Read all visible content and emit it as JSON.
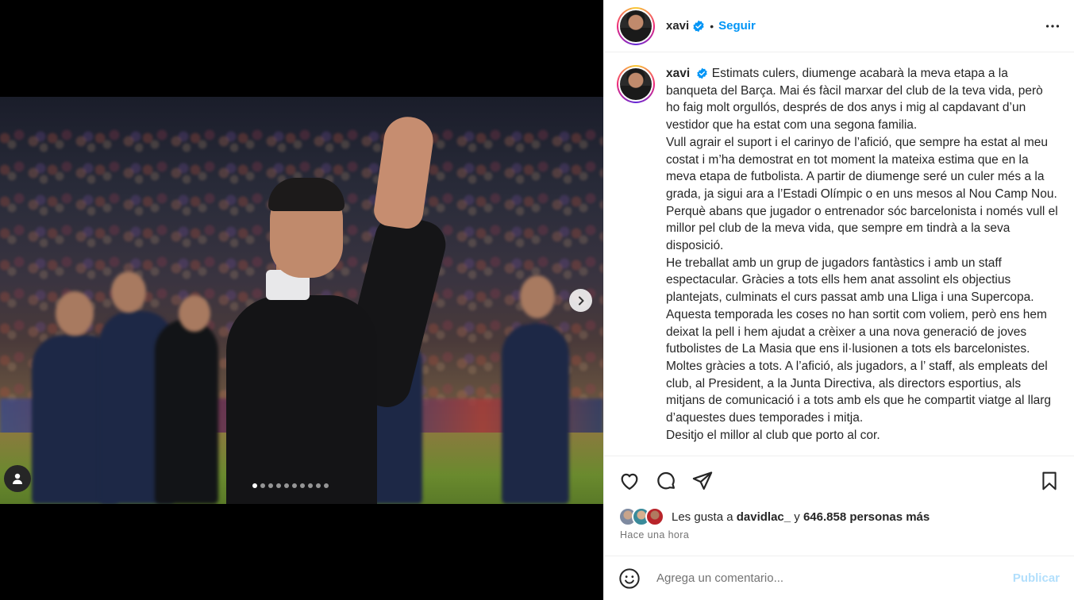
{
  "post": {
    "username": "xavi",
    "verified_icon": "verified-badge-icon",
    "separator": "•",
    "follow_label": "Seguir",
    "carousel_total": 10,
    "carousel_active": 1,
    "caption": "Estimats culers, diumenge acabarà la meva etapa a la banqueta del Barça. Mai és fàcil marxar del club de la teva vida, però ho faig molt orgullós, després de dos anys i mig al capdavant d’un vestidor que ha estat com una segona familia.\nVull agrair el suport i el carinyo de l’afició, que sempre ha estat al meu costat i m’ha demostrat en tot moment la mateixa estima que en la meva etapa de futbolista. A partir de diumenge seré un culer més a la grada, ja sigui ara a l’Estadi Olímpic o en uns mesos al Nou Camp Nou. Perquè abans que jugador o entrenador sóc barcelonista i només vull el millor pel club de la meva vida, que sempre em tindrà a la seva disposició.\nHe treballat amb un grup de jugadors fantàstics i amb un staff espectacular. Gràcies a tots ells hem anat assolint els objectius plantejats, culminats el curs passat amb una Lliga i una Supercopa. Aquesta temporada les coses no han sortit com voliem, però ens hem deixat la pell i hem ajudat a crèixer a una nova generació de joves futbolistes de La Masia que ens il·lusionen a tots els barcelonistes.\nMoltes gràcies a tots. A l’afició, als jugadors, a l’ staff, als empleats del club, al President, a la Junta Directiva, als directors esportius, als mitjans de comunicació i a tots amb els que he compartit viatge al llarg d’aquestes dues temporades i mitja.\nDesitjo el millor al club que porto al cor."
  },
  "likes": {
    "prefix": "Les gusta a",
    "user": "davidlac_",
    "connector": "y",
    "others": "646.858 personas más"
  },
  "time_label": "Hace una hora",
  "comment": {
    "placeholder": "Agrega un comentario...",
    "publish_label": "Publicar"
  },
  "colors": {
    "follow": "#0095f6",
    "publish_disabled": "#b2dffc",
    "text": "#262626",
    "muted": "#737373"
  },
  "icons": [
    "user-tag-icon",
    "next-arrow-icon",
    "more-options-icon",
    "heart-icon",
    "comment-icon",
    "share-icon",
    "bookmark-icon",
    "emoji-icon"
  ]
}
